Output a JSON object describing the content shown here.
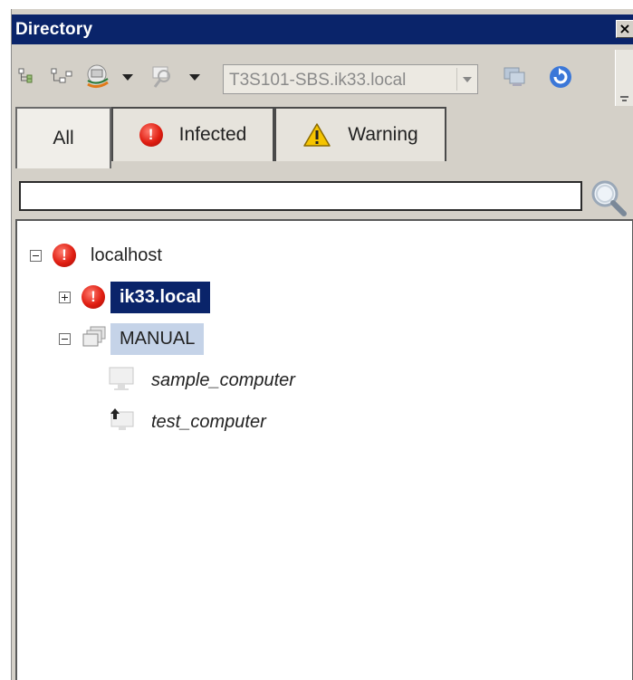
{
  "window": {
    "title": "Directory",
    "close_glyph": "×"
  },
  "toolbar": {
    "icons": [
      "expand-tree-icon",
      "collapse-tree-icon",
      "computer-group-icon",
      "find-computer-icon",
      "computer-view-icon",
      "refresh-icon"
    ],
    "server_combo": {
      "value": "T3S101-SBS.ik33.local"
    }
  },
  "tabs": [
    {
      "label": "All",
      "active": true
    },
    {
      "label": "Infected",
      "icon": "error-icon"
    },
    {
      "label": "Warning",
      "icon": "warning-icon"
    }
  ],
  "search": {
    "placeholder": "",
    "value": "",
    "icon": "magnifier-icon"
  },
  "tree": {
    "nodes": [
      {
        "label": "localhost",
        "icon": "error-icon",
        "expanded": true
      },
      {
        "label": "ik33.local",
        "icon": "error-icon",
        "expanded": false,
        "selected": true
      },
      {
        "label": "MANUAL",
        "icon": "group-icon",
        "expanded": true
      },
      {
        "label": "sample_computer",
        "icon": "computer-icon"
      },
      {
        "label": "test_computer",
        "icon": "computer-upload-icon"
      }
    ]
  },
  "colors": {
    "titlebar": "#0a246a",
    "selection": "#0a246a",
    "hilite": "#c5d3e8",
    "error_red": "#e01e12",
    "warning_yellow": "#f5c400"
  }
}
